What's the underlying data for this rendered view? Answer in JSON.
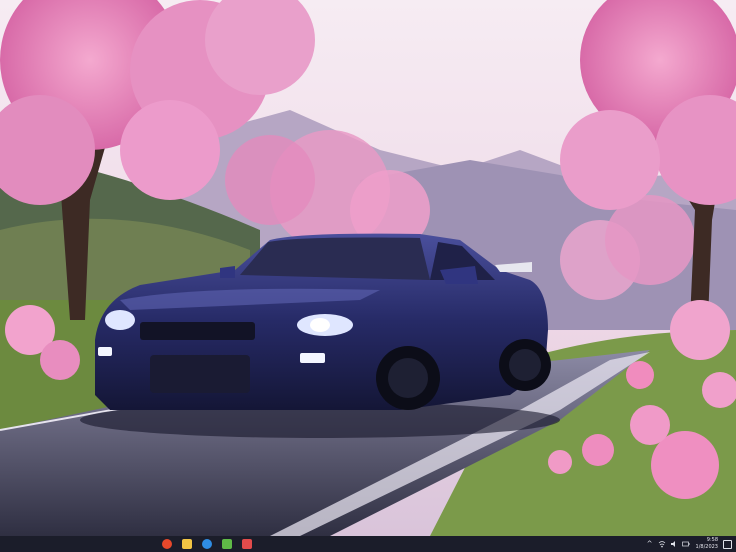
{
  "desktop": {
    "wallpaper_icon": "skyline-cherry-blossom-wallpaper"
  },
  "taskbar": {
    "apps": [
      {
        "name": "start-icon",
        "color": "#e8482b"
      },
      {
        "name": "file-explorer-icon",
        "color": "#f2c544"
      },
      {
        "name": "edge-icon",
        "color": "#2f8de4"
      },
      {
        "name": "store-icon",
        "color": "#5fba47"
      },
      {
        "name": "app-icon",
        "color": "#e24b4b"
      }
    ],
    "tray_icons": [
      "chevron-up-icon",
      "network-icon",
      "volume-icon",
      "battery-icon"
    ],
    "clock": {
      "time": "9:58",
      "date": "1/8/2023"
    }
  }
}
